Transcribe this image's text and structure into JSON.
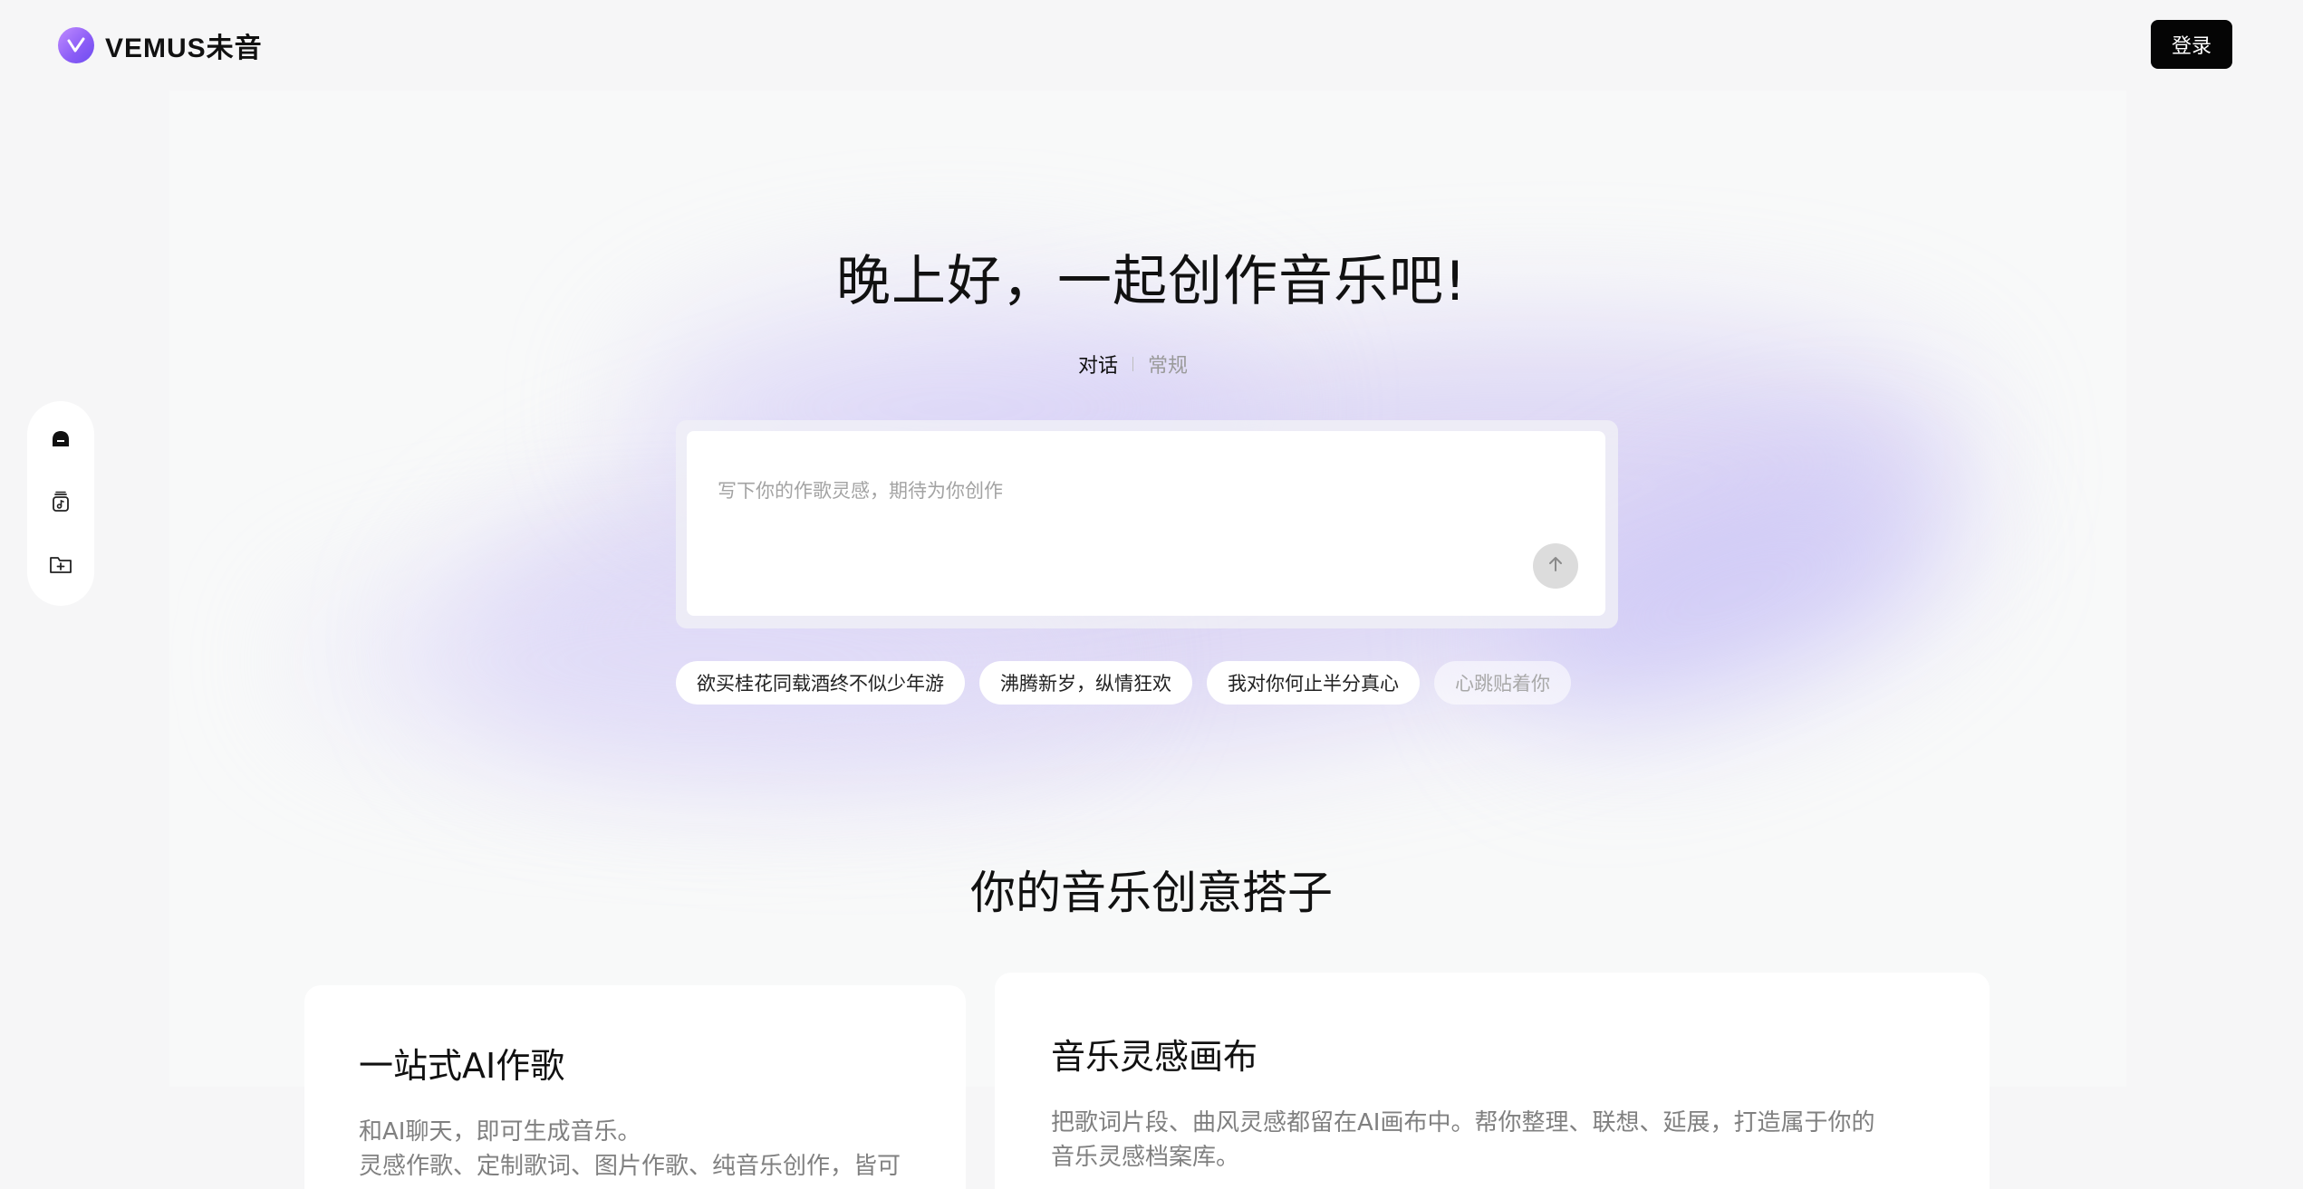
{
  "header": {
    "brand": "VEMUS未音",
    "login_label": "登录"
  },
  "sidebar": {
    "items": [
      {
        "icon": "chat-bubble-icon"
      },
      {
        "icon": "music-library-icon"
      },
      {
        "icon": "new-folder-icon"
      }
    ]
  },
  "hero": {
    "title": "晚上好，一起创作音乐吧!",
    "tabs": [
      {
        "label": "对话",
        "active": true
      },
      {
        "label": "常规",
        "active": false
      }
    ],
    "input": {
      "placeholder": "写下你的作歌灵感，期待为你创作",
      "value": ""
    },
    "suggestions": [
      "欲买桂花同载酒终不似少年游",
      "沸腾新岁，纵情狂欢",
      "我对你何止半分真心",
      "心跳贴着你"
    ]
  },
  "features": {
    "title": "你的音乐创意搭子",
    "cards": [
      {
        "title": "一站式AI作歌",
        "lines": [
          "和AI聊天，即可生成音乐。",
          "灵感作歌、定制歌词、图片作歌、纯音乐创作，皆可"
        ]
      },
      {
        "title": "音乐灵感画布",
        "lines": [
          "把歌词片段、曲风灵感都留在AI画布中。帮你整理、联想、延展，打造属于你的",
          "音乐灵感档案库。"
        ]
      }
    ]
  },
  "colors": {
    "accent": "#8a5cf6",
    "login_bg": "#050505",
    "background": "#f6f6f7"
  }
}
